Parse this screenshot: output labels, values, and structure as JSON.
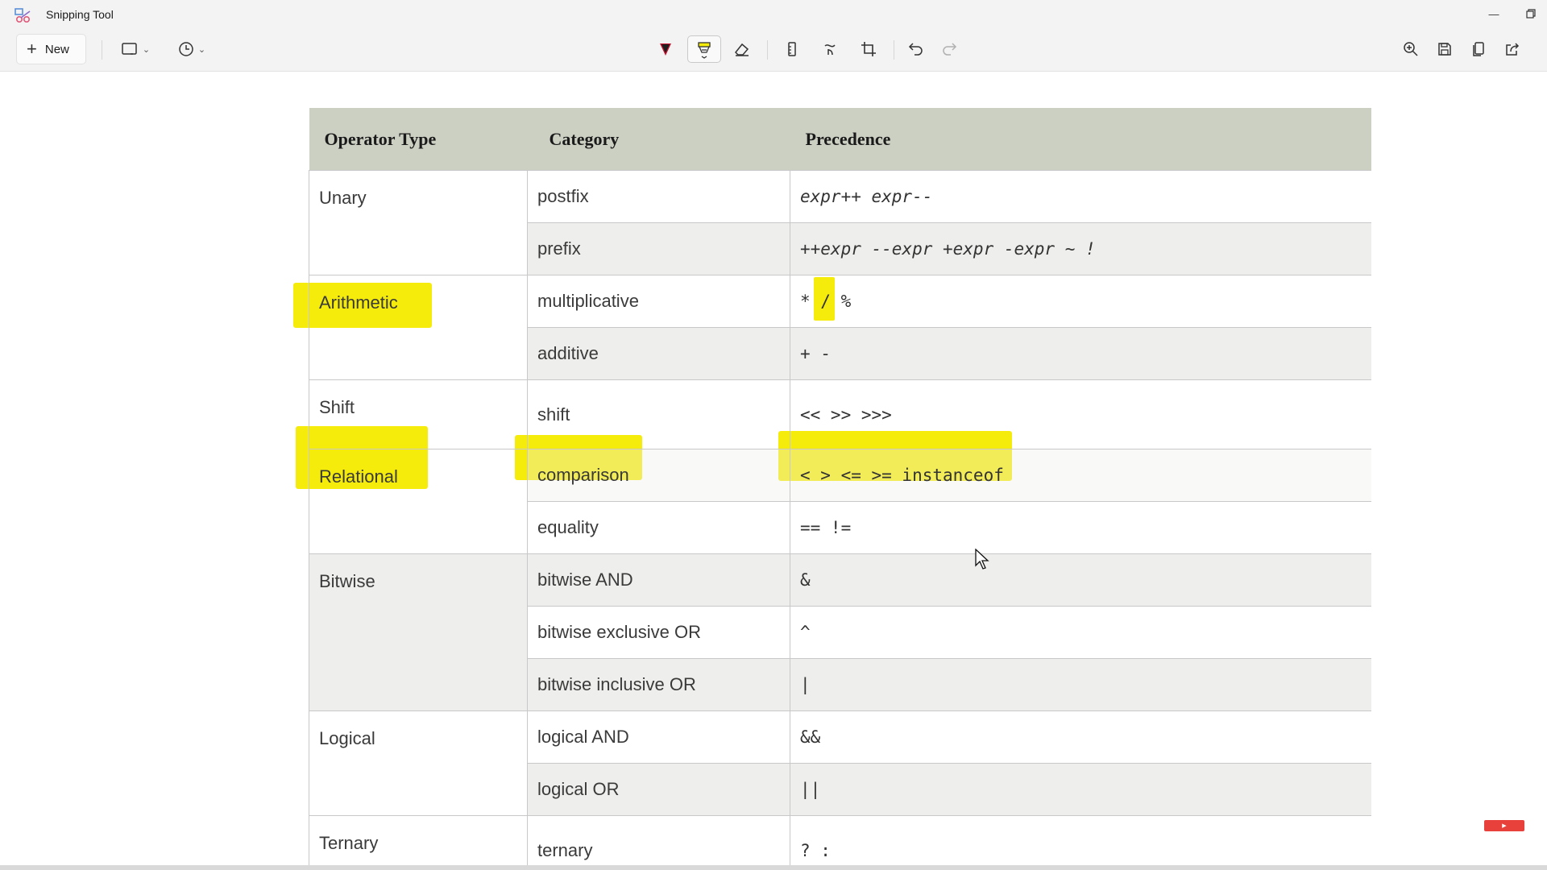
{
  "window": {
    "title": "Snipping Tool"
  },
  "toolbar": {
    "new_label": "New",
    "tools": [
      {
        "icon": "rectangle-mode-icon"
      },
      {
        "icon": "delay-timer-icon"
      },
      {
        "icon": "ballpoint-pen-icon"
      },
      {
        "icon": "highlighter-icon",
        "active": true
      },
      {
        "icon": "eraser-icon"
      },
      {
        "icon": "ruler-icon"
      },
      {
        "icon": "touch-writing-icon"
      },
      {
        "icon": "crop-icon"
      },
      {
        "icon": "undo-icon"
      },
      {
        "icon": "redo-icon"
      },
      {
        "icon": "zoom-icon"
      },
      {
        "icon": "save-icon"
      },
      {
        "icon": "copy-icon"
      },
      {
        "icon": "share-icon"
      }
    ]
  },
  "table": {
    "headers": [
      "Operator Type",
      "Category",
      "Precedence"
    ],
    "rows": [
      {
        "type": "Unary",
        "category": "postfix",
        "precedence": "expr++ expr--"
      },
      {
        "type": "",
        "category": "prefix",
        "precedence": "++expr --expr +expr -expr ~ !"
      },
      {
        "type": "Arithmetic",
        "category": "multiplicative",
        "precedence": "* / %"
      },
      {
        "type": "",
        "category": "additive",
        "precedence": "+ -"
      },
      {
        "type": "Shift",
        "category": "shift",
        "precedence": "<< >> >>>"
      },
      {
        "type": "Relational",
        "category": "comparison",
        "precedence": "< > <= >= instanceof"
      },
      {
        "type": "",
        "category": "equality",
        "precedence": "== !="
      },
      {
        "type": "Bitwise",
        "category": "bitwise AND",
        "precedence": "&"
      },
      {
        "type": "",
        "category": "bitwise exclusive OR",
        "precedence": "^"
      },
      {
        "type": "",
        "category": "bitwise inclusive OR",
        "precedence": "|"
      },
      {
        "type": "Logical",
        "category": "logical AND",
        "precedence": "&&"
      },
      {
        "type": "",
        "category": "logical OR",
        "precedence": "||"
      },
      {
        "type": "Ternary",
        "category": "ternary",
        "precedence": "? :"
      }
    ]
  },
  "colors": {
    "highlight": "#f5ec0c",
    "header_bg": "#ccd0c3",
    "row_shade": "#eeeeec"
  }
}
